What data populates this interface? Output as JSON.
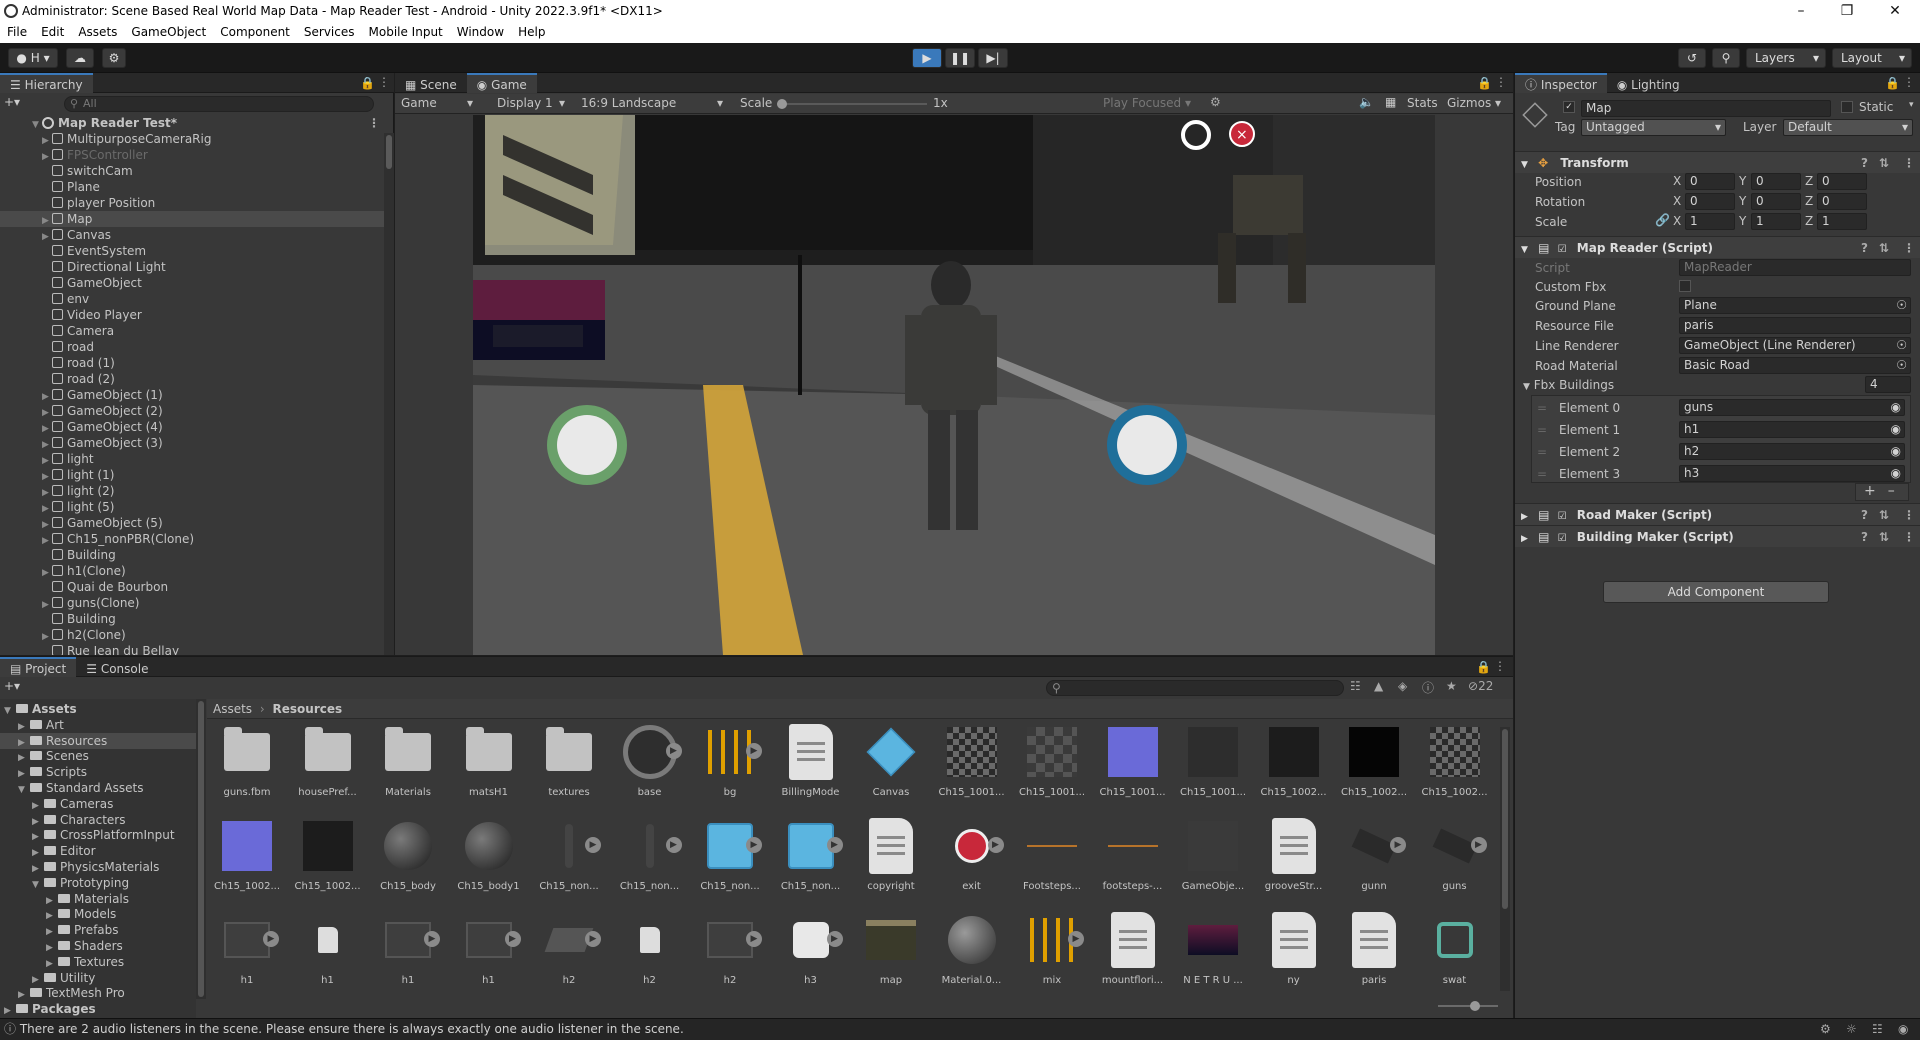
{
  "window": {
    "title": "Administrator: Scene Based Real World Map Data - Map Reader Test - Android - Unity 2022.3.9f1* <DX11>"
  },
  "menu": [
    "File",
    "Edit",
    "Assets",
    "GameObject",
    "Component",
    "Services",
    "Mobile Input",
    "Window",
    "Help"
  ],
  "toolbar": {
    "account": "H",
    "layers_label": "Layers",
    "layout_label": "Layout"
  },
  "hierarchy": {
    "tab": "Hierarchy",
    "search_placeholder": "All",
    "root": "Map Reader Test*",
    "items": [
      "MultipurposeCameraRig",
      "FPSController",
      "switchCam",
      "Plane",
      "player Position",
      "Map",
      "Canvas",
      "EventSystem",
      "Directional Light",
      "GameObject",
      "env",
      "Video Player",
      "Camera",
      "road",
      "road (1)",
      "road (2)",
      "GameObject (1)",
      "GameObject (2)",
      "GameObject (4)",
      "GameObject (3)",
      "light",
      "light (1)",
      "light (2)",
      "light (5)",
      "GameObject (5)",
      "Ch15_nonPBR(Clone)",
      "Building",
      "h1(Clone)",
      "Quai de Bourbon",
      "guns(Clone)",
      "Building",
      "h2(Clone)",
      "Rue Jean du Bellay"
    ]
  },
  "game": {
    "tab_scene": "Scene",
    "tab_game": "Game",
    "mode": "Game",
    "display": "Display 1",
    "aspect": "16:9 Landscape",
    "scale_label": "Scale",
    "scale_value": "1x",
    "play_focused": "Play Focused",
    "stats": "Stats",
    "gizmos": "Gizmos"
  },
  "inspector": {
    "tab_inspector": "Inspector",
    "tab_lighting": "Lighting",
    "object_name": "Map",
    "static_label": "Static",
    "tag_label": "Tag",
    "tag_value": "Untagged",
    "layer_label": "Layer",
    "layer_value": "Default",
    "transform": {
      "title": "Transform",
      "position_label": "Position",
      "position": [
        "0",
        "0",
        "0"
      ],
      "rotation_label": "Rotation",
      "rotation": [
        "0",
        "0",
        "0"
      ],
      "scale_label": "Scale",
      "scale": [
        "1",
        "1",
        "1"
      ]
    },
    "map_reader": {
      "title": "Map Reader (Script)",
      "script_label": "Script",
      "script_value": "MapReader",
      "custom_fbx_label": "Custom Fbx",
      "ground_plane_label": "Ground Plane",
      "ground_plane_value": "Plane",
      "resource_file_label": "Resource File",
      "resource_file_value": "paris",
      "line_renderer_label": "Line Renderer",
      "line_renderer_value": "GameObject (Line Renderer)",
      "road_material_label": "Road Material",
      "road_material_value": "Basic Road",
      "fbx_buildings_label": "Fbx Buildings",
      "fbx_buildings_count": "4",
      "elements": [
        {
          "label": "Element 0",
          "value": "guns"
        },
        {
          "label": "Element 1",
          "value": "h1"
        },
        {
          "label": "Element 2",
          "value": "h2"
        },
        {
          "label": "Element 3",
          "value": "h3"
        }
      ]
    },
    "road_maker": "Road Maker (Script)",
    "building_maker": "Building Maker (Script)",
    "add_component": "Add Component"
  },
  "project": {
    "tab_project": "Project",
    "tab_console": "Console",
    "hidden_count": "22",
    "breadcrumb": [
      "Assets",
      "Resources"
    ],
    "tree": [
      {
        "label": "Assets",
        "depth": 0,
        "bold": true,
        "open": true
      },
      {
        "label": "Art",
        "depth": 1
      },
      {
        "label": "Resources",
        "depth": 1,
        "selected": true
      },
      {
        "label": "Scenes",
        "depth": 1
      },
      {
        "label": "Scripts",
        "depth": 1
      },
      {
        "label": "Standard Assets",
        "depth": 1,
        "open": true
      },
      {
        "label": "Cameras",
        "depth": 2
      },
      {
        "label": "Characters",
        "depth": 2
      },
      {
        "label": "CrossPlatformInput",
        "depth": 2
      },
      {
        "label": "Editor",
        "depth": 2
      },
      {
        "label": "PhysicsMaterials",
        "depth": 2
      },
      {
        "label": "Prototyping",
        "depth": 2,
        "open": true
      },
      {
        "label": "Materials",
        "depth": 3
      },
      {
        "label": "Models",
        "depth": 3
      },
      {
        "label": "Prefabs",
        "depth": 3
      },
      {
        "label": "Shaders",
        "depth": 3
      },
      {
        "label": "Textures",
        "depth": 3
      },
      {
        "label": "Utility",
        "depth": 2
      },
      {
        "label": "TextMesh Pro",
        "depth": 1
      },
      {
        "label": "Packages",
        "depth": 0,
        "bold": true
      }
    ],
    "assets": [
      {
        "label": "guns.fbm",
        "kind": "folder"
      },
      {
        "label": "housePref...",
        "kind": "folder"
      },
      {
        "label": "Materials",
        "kind": "folder"
      },
      {
        "label": "matsH1",
        "kind": "folder"
      },
      {
        "label": "textures",
        "kind": "folder"
      },
      {
        "label": "base",
        "kind": "ring"
      },
      {
        "label": "bg",
        "kind": "mixer"
      },
      {
        "label": "BillingMode",
        "kind": "doc"
      },
      {
        "label": "Canvas",
        "kind": "cube"
      },
      {
        "label": "Ch15_1001...",
        "kind": "tex-gray"
      },
      {
        "label": "Ch15_1001...",
        "kind": "tex-gray2"
      },
      {
        "label": "Ch15_1001...",
        "kind": "tex-normal"
      },
      {
        "label": "Ch15_1001...",
        "kind": "tex-dark"
      },
      {
        "label": "Ch15_1002...",
        "kind": "tex-dark2"
      },
      {
        "label": "Ch15_1002...",
        "kind": "tex-black"
      },
      {
        "label": "Ch15_1002...",
        "kind": "tex-gray"
      },
      {
        "label": "Ch15_1002...",
        "kind": "tex-normal"
      },
      {
        "label": "Ch15_1002...",
        "kind": "tex-dark2"
      },
      {
        "label": "Ch15_body",
        "kind": "sphere"
      },
      {
        "label": "Ch15_body1",
        "kind": "sphere"
      },
      {
        "label": "Ch15_non...",
        "kind": "figure"
      },
      {
        "label": "Ch15_non...",
        "kind": "figure"
      },
      {
        "label": "Ch15_non...",
        "kind": "cube-pack"
      },
      {
        "label": "Ch15_non...",
        "kind": "cube-pack"
      },
      {
        "label": "copyright",
        "kind": "doc"
      },
      {
        "label": "exit",
        "kind": "exit"
      },
      {
        "label": "Footsteps...",
        "kind": "audio"
      },
      {
        "label": "footsteps-...",
        "kind": "audio"
      },
      {
        "label": "GameObje...",
        "kind": "dark-square"
      },
      {
        "label": "grooveStr...",
        "kind": "doc"
      },
      {
        "label": "gunn",
        "kind": "model"
      },
      {
        "label": "guns",
        "kind": "model"
      },
      {
        "label": "h1",
        "kind": "building"
      },
      {
        "label": "h1",
        "kind": "page"
      },
      {
        "label": "h1",
        "kind": "building"
      },
      {
        "label": "h1",
        "kind": "building"
      },
      {
        "label": "h2",
        "kind": "building2"
      },
      {
        "label": "h2",
        "kind": "page"
      },
      {
        "label": "h2",
        "kind": "building"
      },
      {
        "label": "h3",
        "kind": "white-shape"
      },
      {
        "label": "map",
        "kind": "road"
      },
      {
        "label": "Material.0...",
        "kind": "sphere2"
      },
      {
        "label": "mix",
        "kind": "mixer"
      },
      {
        "label": "mountflori...",
        "kind": "doc"
      },
      {
        "label": "N E T R U ...",
        "kind": "picture"
      },
      {
        "label": "ny",
        "kind": "doc"
      },
      {
        "label": "paris",
        "kind": "doc"
      },
      {
        "label": "swat",
        "kind": "prefab-link"
      }
    ]
  },
  "status": {
    "message": "There are 2 audio listeners in the scene. Please ensure there is always exactly one audio listener in the scene."
  },
  "colors": {
    "selection": "#2c5d87",
    "accent": "#3a79bb",
    "panel": "#383838"
  }
}
